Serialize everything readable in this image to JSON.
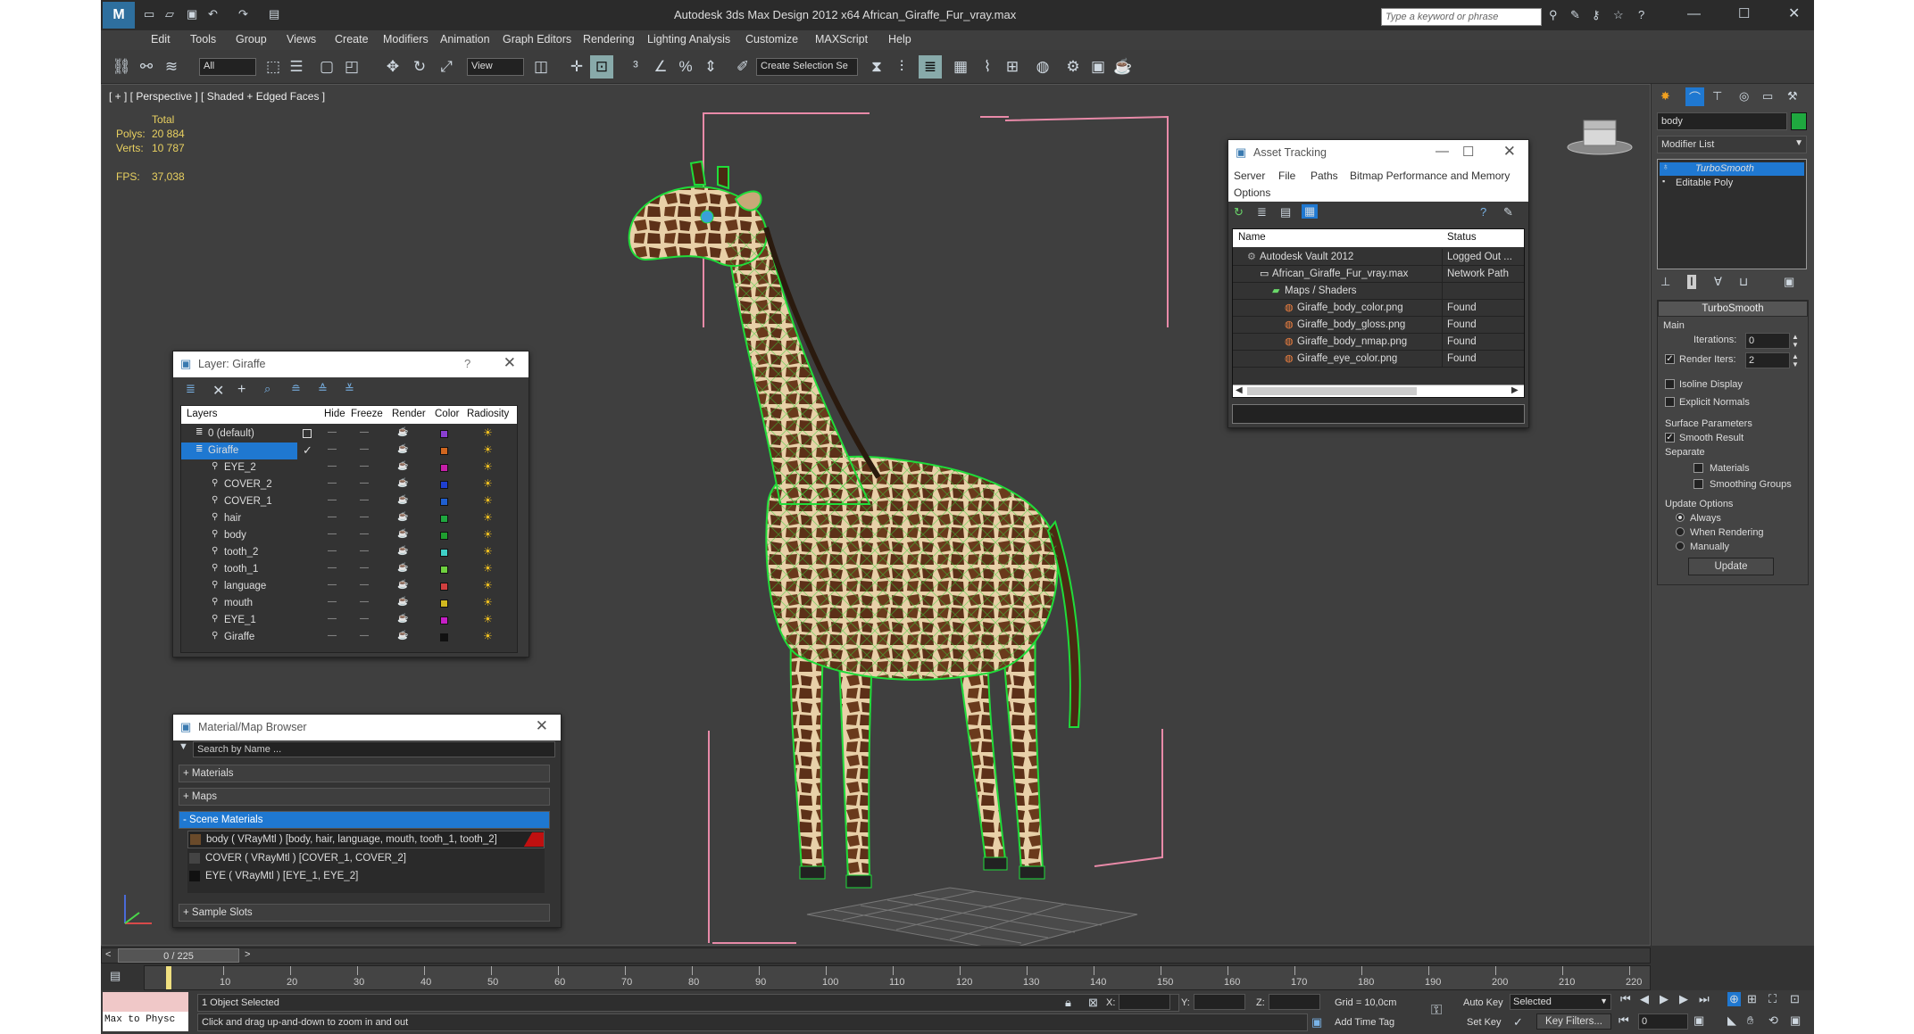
{
  "app": {
    "title": "Autodesk 3ds Max Design 2012 x64    African_Giraffe_Fur_vray.max",
    "search_placeholder": "Type a keyword or phrase",
    "accent": "#1f78d1"
  },
  "menu": [
    "Edit",
    "Tools",
    "Group",
    "Views",
    "Create",
    "Modifiers",
    "Animation",
    "Graph Editors",
    "Rendering",
    "Lighting Analysis",
    "Customize",
    "MAXScript",
    "Help"
  ],
  "toolbar": {
    "filter": "All",
    "ref_coord": "View",
    "selection_set": "Create Selection Se"
  },
  "viewport": {
    "label": "[ + ] [ Perspective ] [ Shaded + Edged Faces ]",
    "stats": {
      "header": "Total",
      "polys_label": "Polys:",
      "polys": "20 884",
      "verts_label": "Verts:",
      "verts": "10 787",
      "fps_label": "FPS:",
      "fps": "37,038"
    }
  },
  "layer_panel": {
    "title": "Layer: Giraffe",
    "help": "?",
    "columns": [
      "Layers",
      "Hide",
      "Freeze",
      "Render",
      "Color",
      "Radiosity"
    ],
    "rows": [
      {
        "name": "0 (default)",
        "color": "#8a3fd1",
        "selected": false,
        "indent": 0
      },
      {
        "name": "Giraffe",
        "color": "#d1661f",
        "selected": true,
        "indent": 0
      },
      {
        "name": "EYE_2",
        "color": "#c61fa8",
        "selected": false,
        "indent": 1
      },
      {
        "name": "COVER_2",
        "color": "#1f3fd1",
        "selected": false,
        "indent": 1
      },
      {
        "name": "COVER_1",
        "color": "#1f5fd1",
        "selected": false,
        "indent": 1
      },
      {
        "name": "hair",
        "color": "#1fa83f",
        "selected": false,
        "indent": 1
      },
      {
        "name": "body",
        "color": "#1f9f2f",
        "selected": false,
        "indent": 1
      },
      {
        "name": "tooth_2",
        "color": "#3fd1c8",
        "selected": false,
        "indent": 1
      },
      {
        "name": "tooth_1",
        "color": "#6fd13f",
        "selected": false,
        "indent": 1
      },
      {
        "name": "language",
        "color": "#d13f3f",
        "selected": false,
        "indent": 1
      },
      {
        "name": "mouth",
        "color": "#d1b81f",
        "selected": false,
        "indent": 1
      },
      {
        "name": "EYE_1",
        "color": "#c61fc6",
        "selected": false,
        "indent": 1
      },
      {
        "name": "Giraffe",
        "color": "#111111",
        "selected": false,
        "indent": 1
      }
    ]
  },
  "material_browser": {
    "title": "Material/Map Browser",
    "search_placeholder": "Search by Name ...",
    "groups": [
      "+ Materials",
      "+ Maps",
      "- Scene Materials",
      "+ Sample Slots"
    ],
    "scene_materials": [
      "body  ( VRayMtl )  [body, hair, language, mouth, tooth_1, tooth_2]",
      "COVER  ( VRayMtl )  [COVER_1, COVER_2]",
      "EYE  ( VRayMtl )  [EYE_1, EYE_2]"
    ]
  },
  "asset_tracking": {
    "title": "Asset Tracking",
    "menu": [
      "Server",
      "File",
      "Paths",
      "Bitmap Performance and Memory",
      "Options"
    ],
    "columns": [
      "Name",
      "Status"
    ],
    "rows": [
      {
        "name": "Autodesk Vault 2012",
        "status": "Logged Out ...",
        "indent": 0
      },
      {
        "name": "African_Giraffe_Fur_vray.max",
        "status": "Network Path",
        "indent": 1
      },
      {
        "name": "Maps / Shaders",
        "status": "",
        "indent": 2
      },
      {
        "name": "Giraffe_body_color.png",
        "status": "Found",
        "indent": 3
      },
      {
        "name": "Giraffe_body_gloss.png",
        "status": "Found",
        "indent": 3
      },
      {
        "name": "Giraffe_body_nmap.png",
        "status": "Found",
        "indent": 3
      },
      {
        "name": "Giraffe_eye_color.png",
        "status": "Found",
        "indent": 3
      }
    ]
  },
  "command_panel": {
    "object_name": "body",
    "object_color": "#1fa83f",
    "modifier_list": "Modifier List",
    "stack": [
      "TurboSmooth",
      "Editable Poly"
    ],
    "turbosmooth": {
      "title": "TurboSmooth",
      "main": "Main",
      "iterations_label": "Iterations:",
      "iterations": "0",
      "render_iters_label": "Render Iters:",
      "render_iters": "2",
      "isoline": "Isoline Display",
      "explicit": "Explicit Normals",
      "surface": "Surface Parameters",
      "smooth": "Smooth Result",
      "separate": "Separate",
      "materials": "Materials",
      "smoothing": "Smoothing Groups",
      "update_opts": "Update Options",
      "always": "Always",
      "when_rendering": "When Rendering",
      "manually": "Manually",
      "update": "Update"
    }
  },
  "timeline": {
    "frame": "0 / 225",
    "ticks": [
      "10",
      "20",
      "30",
      "40",
      "50",
      "60",
      "70",
      "80",
      "90",
      "100",
      "110",
      "120",
      "130",
      "140",
      "150",
      "160",
      "170",
      "180",
      "190",
      "200",
      "210",
      "220"
    ]
  },
  "status": {
    "script_label": "Max to Physc",
    "selected": "1 Object Selected",
    "prompt": "Click and drag up-and-down to zoom in and out",
    "x_label": "X:",
    "y_label": "Y:",
    "z_label": "Z:",
    "grid": "Grid = 10,0cm",
    "add_time_tag": "Add Time Tag",
    "auto_key": "Auto Key",
    "set_key": "Set Key",
    "key_mode": "Selected",
    "key_filters": "Key Filters...",
    "current_frame": "0"
  }
}
